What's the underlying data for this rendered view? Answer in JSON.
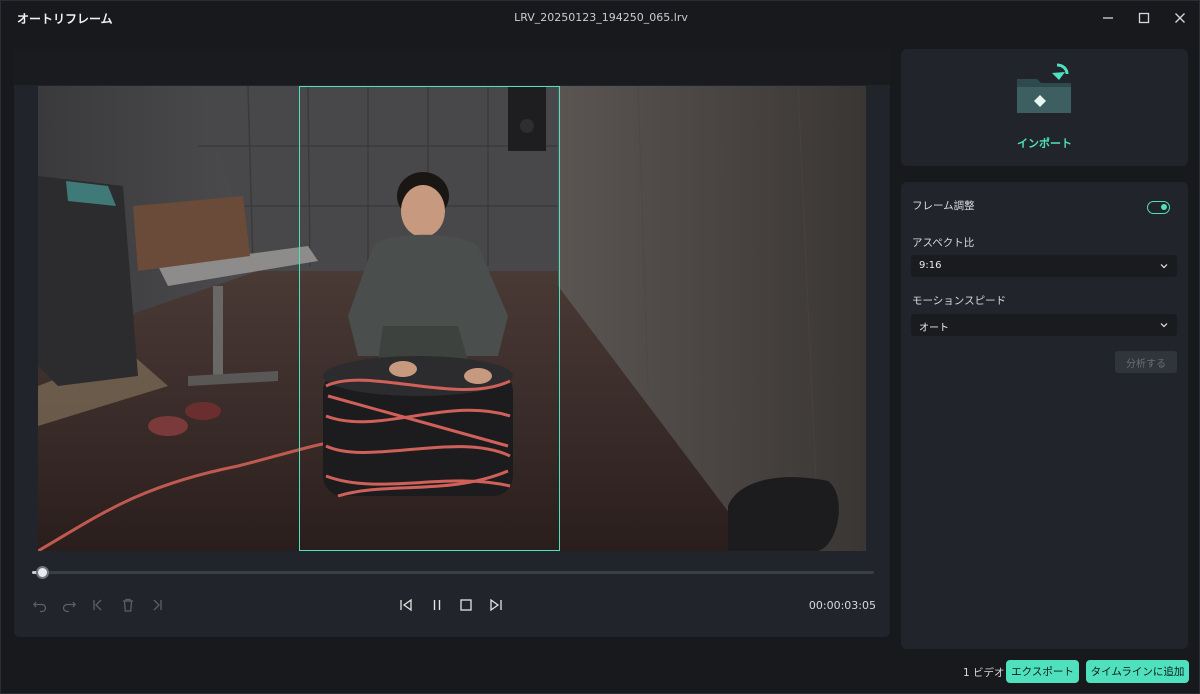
{
  "window": {
    "app_title": "オートリフレーム",
    "file_name": "LRV_20250123_194250_065.lrv"
  },
  "player": {
    "timecode": "00:00:03:05",
    "progress": 0.01
  },
  "import": {
    "label": "インポート"
  },
  "settings": {
    "frame_adjust_label": "フレーム調整",
    "frame_adjust_enabled": true,
    "aspect_label": "アスペクト比",
    "aspect_value": "9:16",
    "motion_label": "モーションスピード",
    "motion_value": "オート",
    "analyze_label": "分析する"
  },
  "footer": {
    "video_count": "1 ビデオ",
    "export_label": "エクスポート",
    "add_timeline_label": "タイムラインに追加"
  },
  "colors": {
    "accent": "#4fe0bd",
    "panel": "#21242a",
    "background": "#17191d"
  }
}
